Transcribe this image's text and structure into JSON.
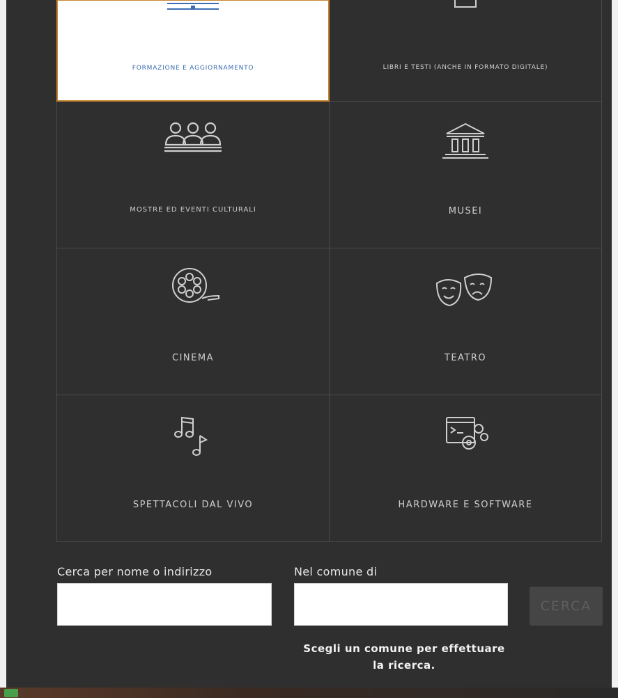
{
  "categories": [
    {
      "id": "formazione",
      "label": "FORMAZIONE E AGGIORNAMENTO",
      "icon": "training-icon",
      "selected": true
    },
    {
      "id": "libri",
      "label": "LIBRI E TESTI (ANCHE IN FORMATO DIGITALE)",
      "icon": "book-icon",
      "selected": false
    },
    {
      "id": "mostre",
      "label": "MOSTRE ED EVENTI CULTURALI",
      "icon": "audience-icon",
      "selected": false
    },
    {
      "id": "musei",
      "label": "MUSEI",
      "icon": "museum-icon",
      "selected": false
    },
    {
      "id": "cinema",
      "label": "CINEMA",
      "icon": "film-reel-icon",
      "selected": false
    },
    {
      "id": "teatro",
      "label": "TEATRO",
      "icon": "theater-masks-icon",
      "selected": false
    },
    {
      "id": "spettacoli",
      "label": "SPETTACOLI DAL VIVO",
      "icon": "music-notes-icon",
      "selected": false
    },
    {
      "id": "hardware",
      "label": "HARDWARE E SOFTWARE",
      "icon": "computer-gears-icon",
      "selected": false
    }
  ],
  "search": {
    "name_label": "Cerca per nome o indirizzo",
    "name_value": "",
    "comune_label": "Nel comune di",
    "comune_value": "",
    "button_label": "CERCA",
    "hint": "Scegli un comune per effettuare la ricerca."
  },
  "colors": {
    "background": "#2f2f2f",
    "selected_border": "#c7862f",
    "selected_label": "#3a6db2",
    "button_disabled": "#454545"
  }
}
